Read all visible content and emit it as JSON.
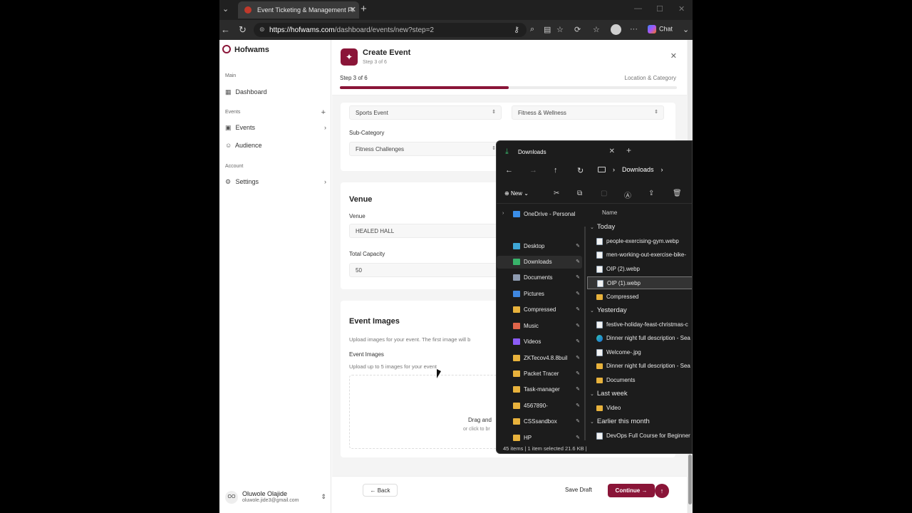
{
  "browser": {
    "tab_title": "Event Ticketing & Management Pl",
    "url_host": "https://hofwams.com",
    "url_path": "/dashboard/events/new?step=2",
    "chat_label": "Chat"
  },
  "sidebar": {
    "brand": "Hofwams",
    "sections": [
      {
        "label": "Main"
      },
      {
        "label": "Events"
      },
      {
        "label": "Account"
      }
    ],
    "items": [
      {
        "label": "Dashboard",
        "icon": "grid-icon"
      },
      {
        "label": "Events",
        "icon": "calendar-icon"
      },
      {
        "label": "Audience",
        "icon": "users-icon"
      },
      {
        "label": "Settings",
        "icon": "gear-icon"
      }
    ],
    "user": {
      "initials": "OO",
      "name": "Oluwole Olajide",
      "email": "oluwole.jide3@gmail.com"
    }
  },
  "wizard": {
    "title": "Create Event",
    "subtitle": "Step 3 of 6",
    "step_text": "Step 3 of 6",
    "step_name": "Location & Category",
    "progress": 0.5,
    "accent": "#8a1538"
  },
  "category": {
    "category_value": "Sports Event",
    "type_value": "Fitness & Wellness",
    "subcategory_label": "Sub-Category",
    "subcategory_value": "Fitness Challenges"
  },
  "venue": {
    "title": "Venue",
    "venue_label": "Venue",
    "venue_value": "HEALED HALL",
    "capacity_label": "Total Capacity",
    "capacity_value": "50"
  },
  "images": {
    "title": "Event Images",
    "description": "Upload images for your event. The first image will b",
    "field_label": "Event Images",
    "field_hint": "Upload up to 5 images for your event",
    "drop_text": "Drag and",
    "drop_sub": "or click to br"
  },
  "footer": {
    "back": "Back",
    "save_draft": "Save Draft",
    "continue": "Continue"
  },
  "explorer": {
    "tab_title": "Downloads",
    "path": "Downloads",
    "new_label": "New",
    "column_name": "Name",
    "nav": [
      {
        "label": "OneDrive - Personal",
        "color": "#3b8ee8"
      },
      {
        "label": "Desktop",
        "color": "#3fa7d6"
      },
      {
        "label": "Downloads",
        "color": "#38b36a"
      },
      {
        "label": "Documents",
        "color": "#8e9bb0"
      },
      {
        "label": "Pictures",
        "color": "#3f87e0"
      },
      {
        "label": "Compressed",
        "color": "#e8b23c"
      },
      {
        "label": "Music",
        "color": "#e0654a"
      },
      {
        "label": "Videos",
        "color": "#8b5cf6"
      },
      {
        "label": "ZKTecov4.8.8buil",
        "color": "#e8b23c"
      },
      {
        "label": "Packet Tracer",
        "color": "#e8b23c"
      },
      {
        "label": "Task-manager",
        "color": "#e8b23c"
      },
      {
        "label": "4567890-",
        "color": "#e8b23c"
      },
      {
        "label": "CSSsandbox",
        "color": "#e8b23c"
      },
      {
        "label": "HP",
        "color": "#e8b23c"
      }
    ],
    "groups": [
      {
        "label": "Today"
      },
      {
        "label": "Yesterday"
      },
      {
        "label": "Last week"
      },
      {
        "label": "Earlier this month"
      }
    ],
    "files": [
      {
        "label": "people-exercising-gym.webp",
        "kind": "file"
      },
      {
        "label": "men-working-out-exercise-bike-",
        "kind": "file"
      },
      {
        "label": "OIP (2).webp",
        "kind": "file"
      },
      {
        "label": "OIP (1).webp",
        "kind": "file"
      },
      {
        "label": "Compressed",
        "kind": "folder"
      },
      {
        "label": "festive-holiday-feast-christmas-c",
        "kind": "file"
      },
      {
        "label": "Dinner night full description - Sea",
        "kind": "edge"
      },
      {
        "label": "Welcome-.jpg",
        "kind": "file"
      },
      {
        "label": "Dinner night full description - Sea",
        "kind": "folder"
      },
      {
        "label": "Documents",
        "kind": "folder"
      },
      {
        "label": "Video",
        "kind": "folder"
      },
      {
        "label": "DevOps Full Course for Beginner",
        "kind": "file"
      }
    ],
    "status": "45 items  |  1 item selected  21.6 KB  |"
  }
}
